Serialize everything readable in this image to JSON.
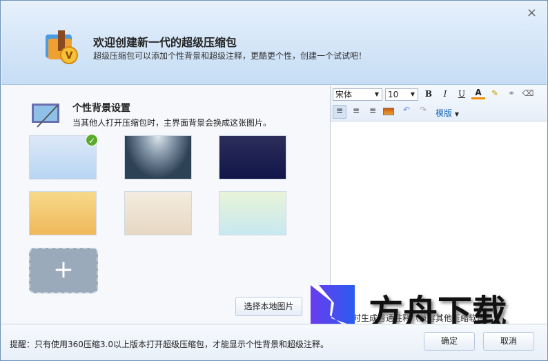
{
  "header": {
    "title": "欢迎创建新一代的超级压缩包",
    "subtitle": "超级压缩包可以添加个性背景和超级注释，更酷更个性，创建一个试试吧！",
    "close": "×"
  },
  "background": {
    "title": "个性背景设置",
    "subtitle": "当其他人打开压缩包时，主界面背景会换成这张图片。",
    "add": "+",
    "choose_local": "选择本地图片",
    "selected_index": 0
  },
  "editor": {
    "font": "宋体",
    "size": "10",
    "bold": "B",
    "italic": "I",
    "underline": "U",
    "font_color": "A",
    "template": "模版",
    "option_text": "时生成普通注释（兼容其他压缩软件）"
  },
  "footer": {
    "tip": "提醒：只有使用360压缩3.0以上版本打开超级压缩包，才能显示个性背景和超级注释。",
    "ok": "确定",
    "cancel": "取消"
  },
  "watermark": "方舟下载"
}
